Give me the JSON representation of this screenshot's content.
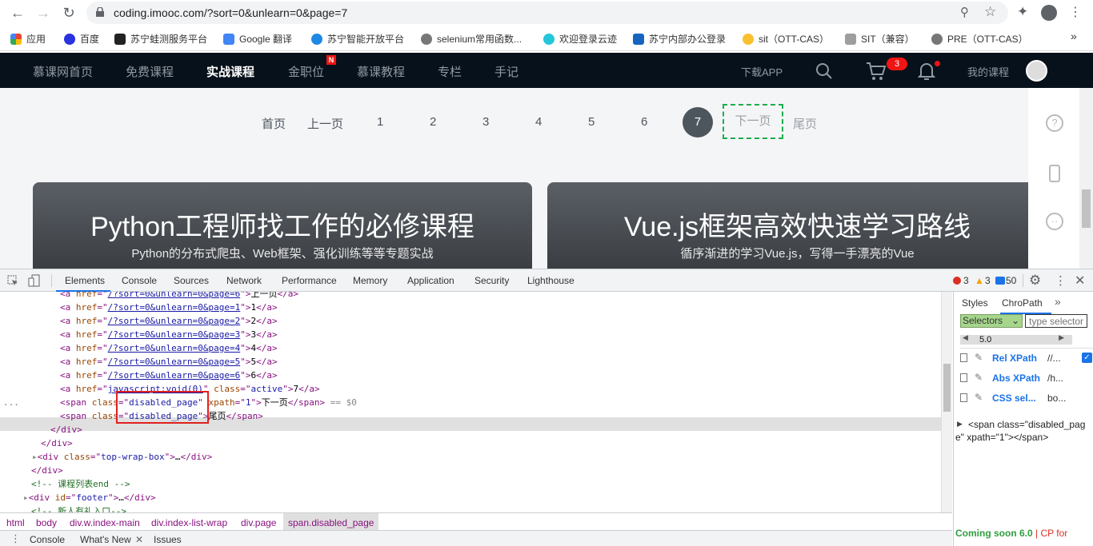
{
  "browser": {
    "url": "coding.imooc.com/?sort=0&unlearn=0&page=7",
    "bookmarks": [
      "应用",
      "百度",
      "苏宁蛙测服务平台",
      "Google 翻译",
      "苏宁智能开放平台",
      "selenium常用函数...",
      "欢迎登录云迹",
      "苏宁内部办公登录",
      "sit（OTT-CAS）",
      "SIT（兼容）",
      "PRE（OTT-CAS）"
    ],
    "more": "»"
  },
  "site": {
    "nav": [
      "慕课网首页",
      "免费课程",
      "实战课程",
      "金职位",
      "慕课教程",
      "专栏",
      "手记"
    ],
    "new_badge": "N",
    "download": "下载APP",
    "cart_count": "3",
    "my_courses": "我的课程"
  },
  "pager": {
    "first": "首页",
    "prev": "上一页",
    "pages": [
      "1",
      "2",
      "3",
      "4",
      "5",
      "6"
    ],
    "current": "7",
    "next": "下一页",
    "last": "尾页"
  },
  "banners": [
    {
      "title": "Python工程师找工作的必修课程",
      "subtitle": "Python的分布式爬虫、Web框架、强化训练等等专题实战"
    },
    {
      "title": "Vue.js框架高效快速学习路线",
      "subtitle": "循序渐进的学习Vue.js，写得一手漂亮的Vue"
    }
  ],
  "devtools": {
    "tabs": [
      "Elements",
      "Console",
      "Sources",
      "Network",
      "Performance",
      "Memory",
      "Application",
      "Security",
      "Lighthouse"
    ],
    "errors": "3",
    "warnings": "3",
    "messages": "50",
    "dom_lines": {
      "l0_href": "/?sort=0&unlearn=0&page=6",
      "l0_text": "上一页",
      "l1_href": "/?sort=0&unlearn=0&page=1",
      "l1_text": "1",
      "l2_href": "/?sort=0&unlearn=0&page=2",
      "l2_text": "2",
      "l3_href": "/?sort=0&unlearn=0&page=3",
      "l3_text": "3",
      "l4_href": "/?sort=0&unlearn=0&page=4",
      "l4_text": "4",
      "l5_href": "/?sort=0&unlearn=0&page=5",
      "l5_text": "5",
      "l6_href": "/?sort=0&unlearn=0&page=6",
      "l6_text": "6",
      "l7_href": "javascript:void(0)",
      "l7_class": "active",
      "l7_text": "7",
      "l8_class": "disabled_page",
      "l8_xpath": "1",
      "l8_text": "下一页",
      "l8_eq": "== $0",
      "l9_class": "disabled_page",
      "l9_text": "尾页",
      "l12_class": "top-wrap-box",
      "l14_comment": "<!-- 课程列表end -->",
      "l15_id": "footer",
      "l16_comment": "<!-- 新人有礼入口-->"
    },
    "breadcrumbs": [
      "html",
      "body",
      "div.w.index-main",
      "div.index-list-wrap",
      "div.page",
      "span.disabled_page"
    ],
    "drawer": [
      "Console",
      "What's New",
      "Issues"
    ],
    "side": {
      "tabs": [
        "Styles",
        "ChroPath"
      ],
      "selector_mode": "Selectors",
      "input_placeholder": "type selector",
      "version": "5.0",
      "rows": [
        {
          "label": "Rel XPath",
          "value": "//..."
        },
        {
          "label": "Abs XPath",
          "value": "/h..."
        },
        {
          "label": "CSS sel...",
          "value": "bo..."
        }
      ],
      "preview": "<span class=\"disabled_page\" xpath=\"1\"></span>",
      "footer_a": "Coming soon 6.0",
      "footer_b": "| CP for"
    }
  },
  "colors": {
    "nav_bg": "#07111b",
    "accent_green": "#1dad4e",
    "badge_red": "#f01414",
    "highlight_red": "#e02020"
  }
}
